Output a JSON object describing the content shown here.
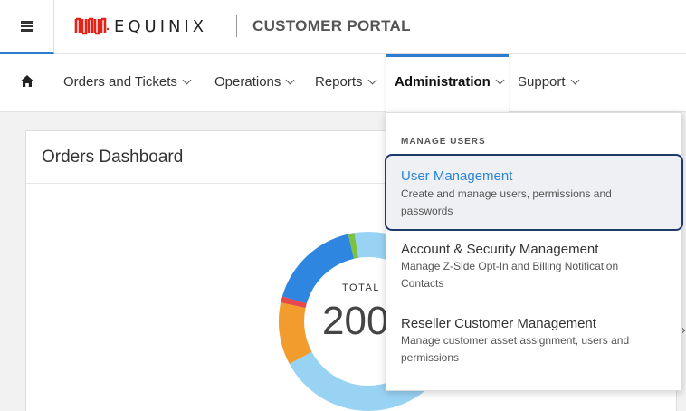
{
  "header": {
    "logo_text": "EQUINIX",
    "portal_title": "CUSTOMER PORTAL",
    "menu_icon": "hamburger-icon",
    "brand_color": "#e2231a"
  },
  "nav": {
    "home_icon": "home-icon",
    "items": [
      {
        "label": "Orders and Tickets"
      },
      {
        "label": "Operations"
      },
      {
        "label": "Reports"
      },
      {
        "label": "Administration",
        "active": true
      },
      {
        "label": "Support"
      }
    ],
    "accent_color": "#2b7bd1"
  },
  "dashboard": {
    "title": "Orders Dashboard",
    "total_label": "TOTAL",
    "total_value": "200"
  },
  "dropdown": {
    "heading": "MANAGE USERS",
    "items": [
      {
        "title": "User Management",
        "description": "Create and manage users, permissions and passwords",
        "highlighted": true
      },
      {
        "title": "Account & Security Management",
        "description": "Manage Z-Side Opt-In and Billing Notification Contacts"
      },
      {
        "title": "Reseller Customer Management",
        "description": "Manage customer asset assignment, users and permissions"
      }
    ]
  }
}
